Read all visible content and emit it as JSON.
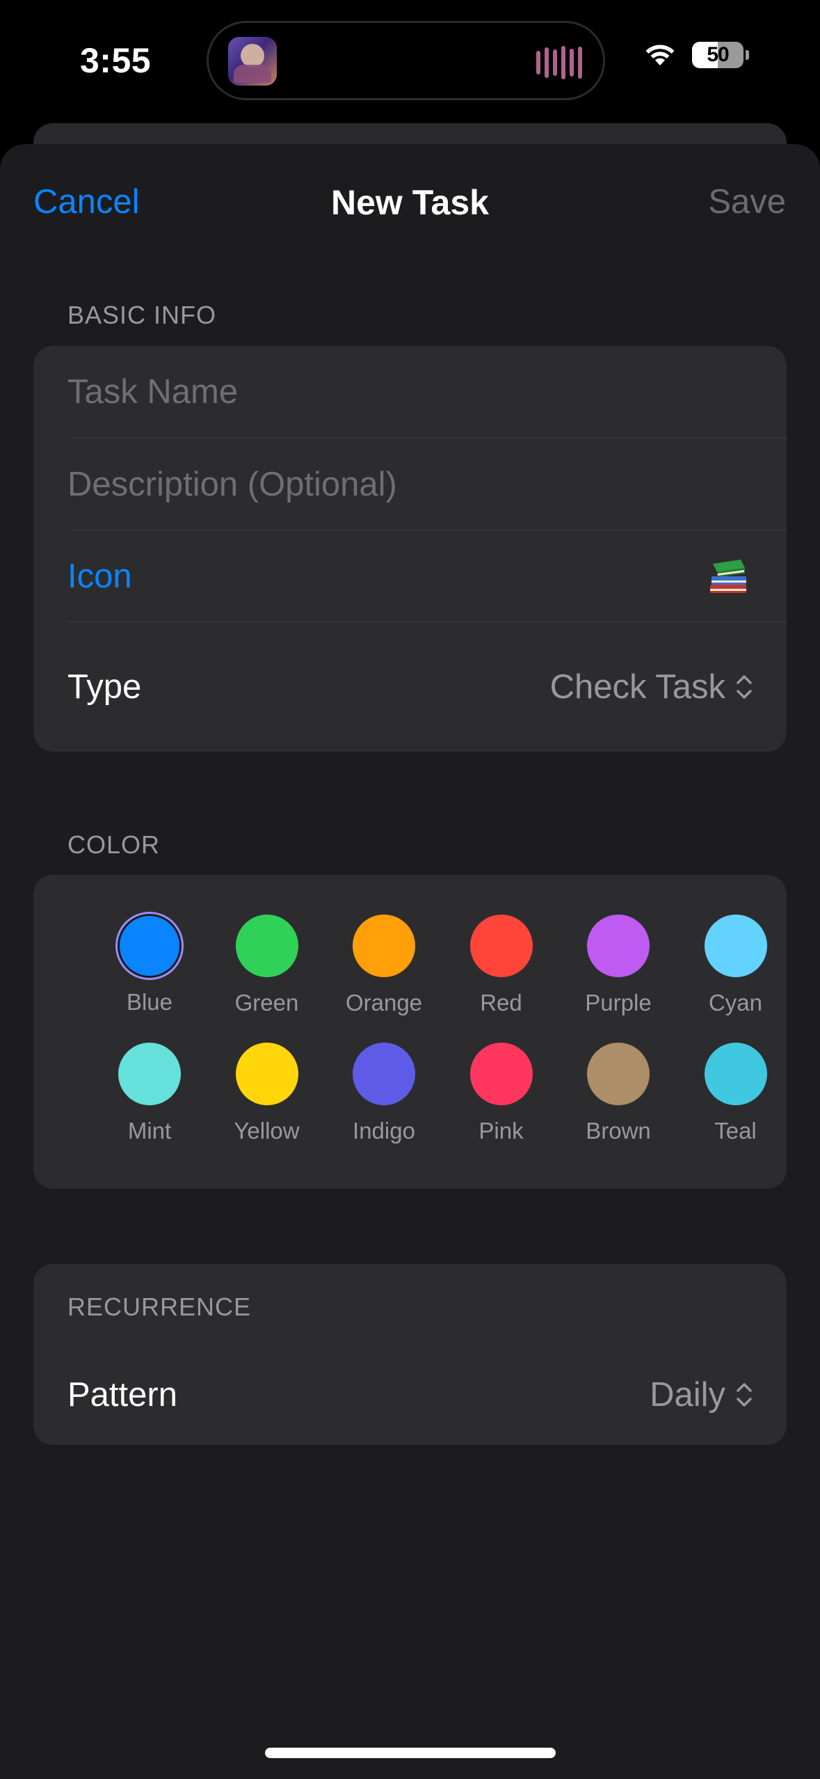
{
  "status_bar": {
    "time": "3:55",
    "battery": "50",
    "battery_level": 0.5,
    "wifi_icon": "wifi-icon",
    "now_playing_icon": "album-art-icon",
    "waveform_icon": "audio-waveform-icon"
  },
  "nav": {
    "cancel_label": "Cancel",
    "title": "New Task",
    "save_label": "Save"
  },
  "basic_info": {
    "header": "BASIC INFO",
    "task_name_placeholder": "Task Name",
    "task_name_value": "",
    "description_placeholder": "Description (Optional)",
    "description_value": "",
    "icon_label": "Icon",
    "icon_value": "books-icon",
    "type_label": "Type",
    "type_value": "Check Task"
  },
  "color": {
    "header": "COLOR",
    "selected": "Blue",
    "options": [
      {
        "name": "Blue",
        "hex": "#0a84ff"
      },
      {
        "name": "Green",
        "hex": "#30d158"
      },
      {
        "name": "Orange",
        "hex": "#ff9f0a"
      },
      {
        "name": "Red",
        "hex": "#ff453a"
      },
      {
        "name": "Purple",
        "hex": "#bf5af2"
      },
      {
        "name": "Cyan",
        "hex": "#64d2ff"
      },
      {
        "name": "Mint",
        "hex": "#66e0da"
      },
      {
        "name": "Yellow",
        "hex": "#ffd60a"
      },
      {
        "name": "Indigo",
        "hex": "#5e5ce6"
      },
      {
        "name": "Pink",
        "hex": "#ff375f"
      },
      {
        "name": "Brown",
        "hex": "#ac8e68"
      },
      {
        "name": "Teal",
        "hex": "#40c8e0"
      }
    ]
  },
  "recurrence": {
    "header": "RECURRENCE",
    "pattern_label": "Pattern",
    "pattern_value": "Daily"
  },
  "colors": {
    "accent": "#0a84ff",
    "background": "#1c1c1e",
    "group_background": "#2c2c2e",
    "secondary_text": "#98989f",
    "placeholder_text": "#6e6e73"
  }
}
